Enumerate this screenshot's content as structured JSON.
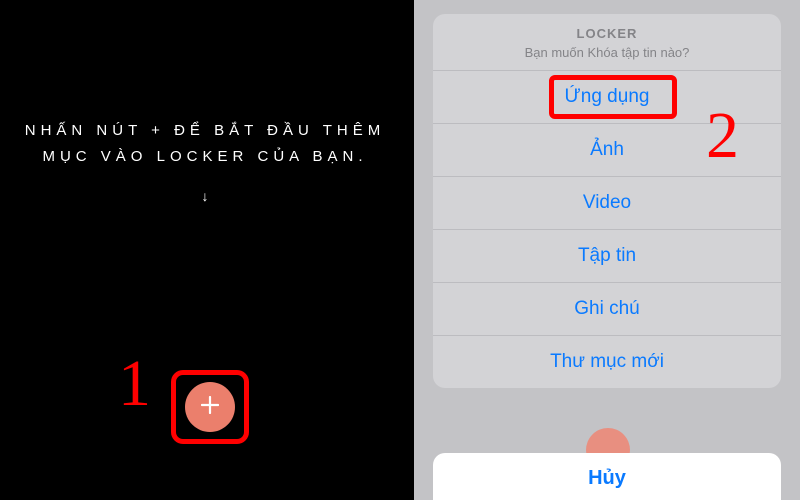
{
  "left": {
    "intro_line1": "Nhấn nút + để bắt đầu thêm",
    "intro_line2": "mục vào Locker của bạn.",
    "arrow": "↓",
    "step_label": "1"
  },
  "right": {
    "title": "LOCKER",
    "subtitle": "Bạn muốn Khóa tập tin nào?",
    "options": {
      "o0": "Ứng dụng",
      "o1": "Ảnh",
      "o2": "Video",
      "o3": "Tập tin",
      "o4": "Ghi chú",
      "o5": "Thư mục mới"
    },
    "cancel": "Hủy",
    "step_label": "2"
  },
  "colors": {
    "annotation": "#ff0000",
    "ios_blue": "#0a7aff",
    "fab": "#eb7f6c"
  }
}
